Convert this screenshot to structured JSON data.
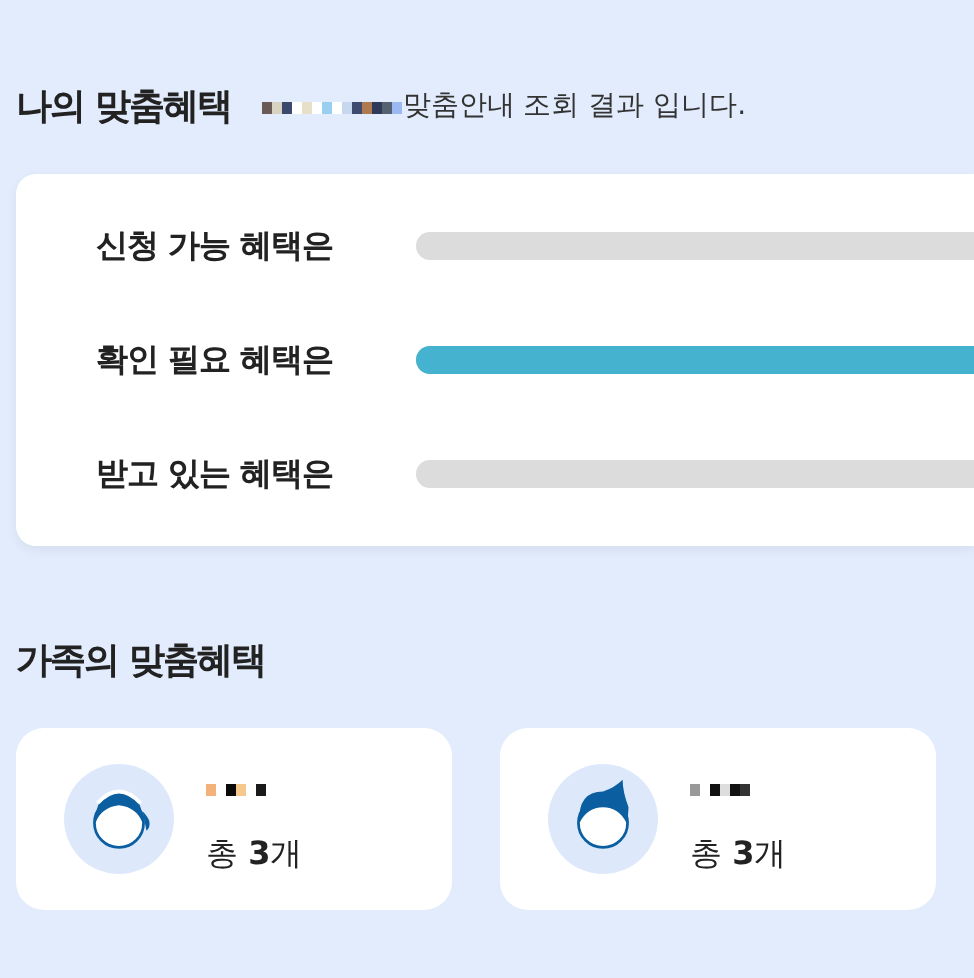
{
  "my_benefits": {
    "title": "나의 맞춤혜택",
    "name_masked": true,
    "caption": "맞춤안내 조회 결과 입니다."
  },
  "benefit_bars": [
    {
      "label": "신청 가능 혜택은",
      "level": 0
    },
    {
      "label": "확인 필요 혜택은",
      "level": 1
    },
    {
      "label": "받고 있는 혜택은",
      "level": 0
    }
  ],
  "family": {
    "title": "가족의 맞춤혜택",
    "members": [
      {
        "kind": "girl",
        "name_masked": true,
        "count_prefix": "총 ",
        "count": "3",
        "count_suffix": "개"
      },
      {
        "kind": "boy",
        "name_masked": true,
        "count_prefix": "총 ",
        "count": "3",
        "count_suffix": "개"
      }
    ]
  }
}
